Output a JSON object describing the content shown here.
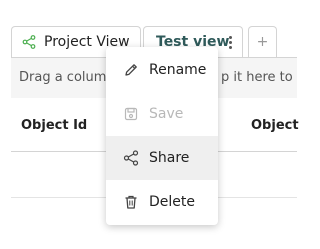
{
  "tabs": [
    {
      "label": "Project View",
      "icon": "share-icon"
    },
    {
      "label": "Test view",
      "icon": "kebab-menu-icon",
      "active": true
    },
    {
      "label": "+",
      "icon": "add-icon"
    }
  ],
  "group_bar": {
    "text": "Drag a colum",
    "text_right": "p it here to g"
  },
  "columns": {
    "left": "Object Id",
    "right": "Object"
  },
  "menu": {
    "items": [
      {
        "label": "Rename",
        "icon": "pencil-icon",
        "disabled": false
      },
      {
        "label": "Save",
        "icon": "save-icon",
        "disabled": true
      },
      {
        "label": "Share",
        "icon": "share-icon",
        "disabled": false,
        "hovered": true
      },
      {
        "label": "Delete",
        "icon": "trash-icon",
        "disabled": false
      }
    ]
  },
  "colors": {
    "active_tab_text": "#2f5a5a",
    "share_icon_green": "#4caf50",
    "hover_bg": "#efefef",
    "disabled_text": "#b8b8b8"
  }
}
